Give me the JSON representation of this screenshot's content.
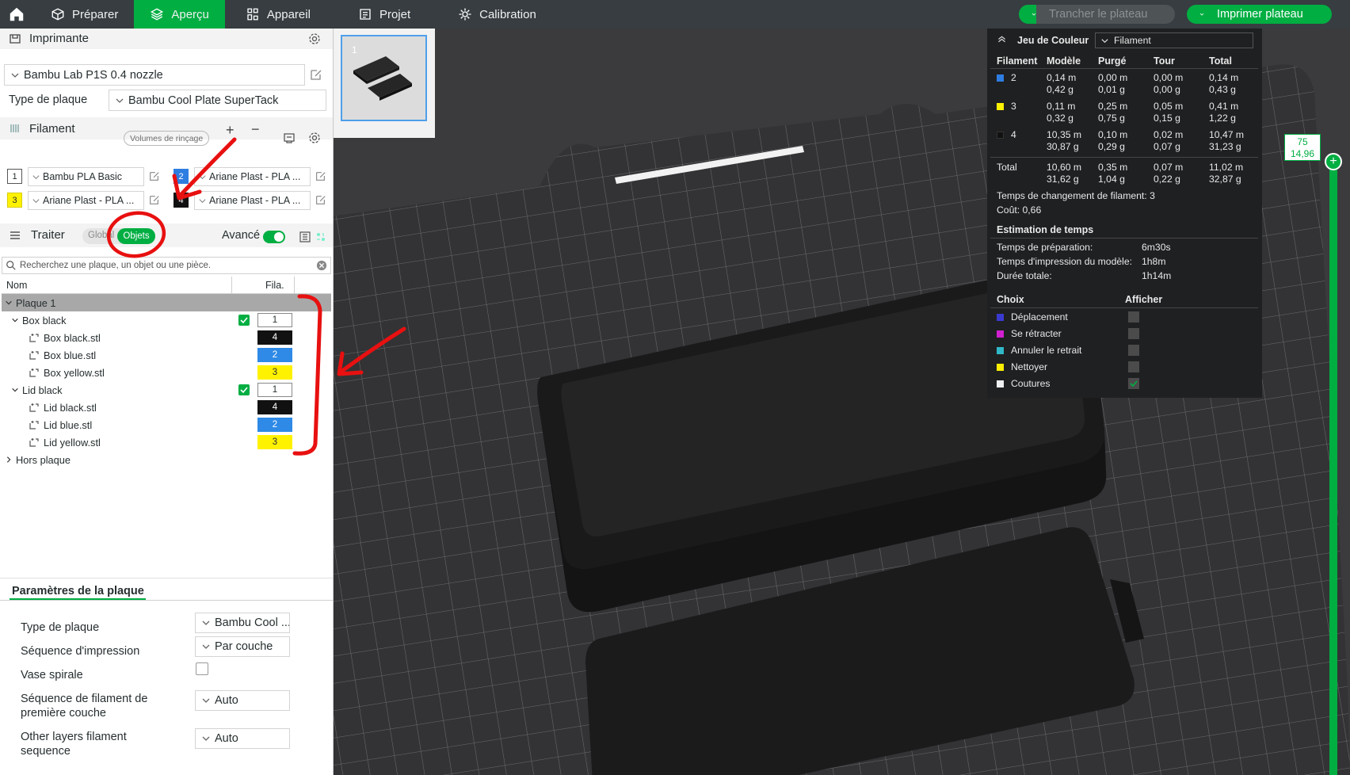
{
  "topbar": {
    "tabs": [
      {
        "label": "Préparer",
        "icon": "cube-icon"
      },
      {
        "label": "Aperçu",
        "icon": "layers-icon",
        "active": true
      },
      {
        "label": "Appareil",
        "icon": "device-icon"
      },
      {
        "label": "Projet",
        "icon": "project-icon"
      },
      {
        "label": "Calibration",
        "icon": "calibration-icon"
      }
    ],
    "slice_button": "Trancher le plateau",
    "print_button": "Imprimer plateau"
  },
  "printer": {
    "title": "Imprimante",
    "selected": "Bambu Lab P1S 0.4 nozzle",
    "plate_type_label": "Type de plaque",
    "plate_type_value": "Bambu Cool Plate SuperTack"
  },
  "filament": {
    "title": "Filament",
    "flush_button": "Volumes de rinçage",
    "slots": [
      {
        "num": "1",
        "name": "Bambu PLA Basic",
        "color": "#ffffff"
      },
      {
        "num": "2",
        "name": "Ariane Plast - PLA ...",
        "color": "#2e7de1"
      },
      {
        "num": "3",
        "name": "Ariane Plast - PLA ...",
        "color": "#fff200"
      },
      {
        "num": "4",
        "name": "Ariane Plast - PLA ...",
        "color": "#111111"
      }
    ]
  },
  "process": {
    "title": "Traiter",
    "global_tab": "Global",
    "objects_tab": "Objets",
    "advanced_label": "Avancé",
    "search_placeholder": "Recherchez une plaque, un objet ou une pièce.",
    "col_name": "Nom",
    "col_fila": "Fila."
  },
  "tree": {
    "plate": "Plaque 1",
    "objects": [
      {
        "name": "Box black",
        "fila": "1",
        "parts": [
          {
            "name": "Box black.stl",
            "fila": "4",
            "color": "#111111",
            "text": "#ffffff"
          },
          {
            "name": "Box blue.stl",
            "fila": "2",
            "color": "#2e8ae6",
            "text": "#ffffff"
          },
          {
            "name": "Box yellow.stl",
            "fila": "3",
            "color": "#fff200",
            "text": "#262e30"
          }
        ]
      },
      {
        "name": "Lid black",
        "fila": "1",
        "parts": [
          {
            "name": "Lid black.stl",
            "fila": "4",
            "color": "#111111",
            "text": "#ffffff"
          },
          {
            "name": "Lid blue.stl",
            "fila": "2",
            "color": "#2e8ae6",
            "text": "#ffffff"
          },
          {
            "name": "Lid yellow.stl",
            "fila": "3",
            "color": "#fff200",
            "text": "#262e30"
          }
        ]
      }
    ],
    "off_plate": "Hors plaque"
  },
  "plate_params": {
    "title": "Paramètres de la plaque",
    "plate_type_label": "Type de plaque",
    "plate_type_value": "Bambu Cool ...",
    "print_seq_label": "Séquence d'impression",
    "print_seq_value": "Par couche",
    "vase_label": "Vase spirale",
    "first_layer_label_1": "Séquence de filament de",
    "first_layer_label_2": "première couche",
    "first_layer_value": "Auto",
    "other_layers_label_1": "Other layers filament",
    "other_layers_label_2": "sequence",
    "other_layers_value": "Auto"
  },
  "thumbnail": {
    "number": "1"
  },
  "legend": {
    "title": "Jeu de Couleur",
    "mode": "Filament",
    "headers": [
      "Filament",
      "Modèle",
      "Purgé",
      "Tour",
      "Total"
    ],
    "rows": [
      {
        "id": "2",
        "color": "#2e7de1",
        "model": [
          "0,14 m",
          "0,42 g"
        ],
        "purged": [
          "0,00 m",
          "0,01 g"
        ],
        "tower": [
          "0,00 m",
          "0,00 g"
        ],
        "total": [
          "0,14 m",
          "0,43 g"
        ]
      },
      {
        "id": "3",
        "color": "#fff200",
        "model": [
          "0,11 m",
          "0,32 g"
        ],
        "purged": [
          "0,25 m",
          "0,75 g"
        ],
        "tower": [
          "0,05 m",
          "0,15 g"
        ],
        "total": [
          "0,41 m",
          "1,22 g"
        ]
      },
      {
        "id": "4",
        "color": "#111111",
        "model": [
          "10,35 m",
          "30,87 g"
        ],
        "purged": [
          "0,10 m",
          "0,29 g"
        ],
        "tower": [
          "0,02 m",
          "0,07 g"
        ],
        "total": [
          "10,47 m",
          "31,23 g"
        ]
      }
    ],
    "total_row": {
      "label": "Total",
      "model": [
        "10,60 m",
        "31,62 g"
      ],
      "purged": [
        "0,35 m",
        "1,04 g"
      ],
      "tower": [
        "0,07 m",
        "0,22 g"
      ],
      "total": [
        "11,02 m",
        "32,87 g"
      ]
    },
    "changes": "Temps de changement de filament:  3",
    "cost": "Coût:  0,66",
    "time_title": "Estimation de temps",
    "prep_label": "Temps de préparation:",
    "prep_value": "6m30s",
    "model_time_label": "Temps d'impression du modèle:",
    "model_time_value": "1h8m",
    "total_time_label": "Durée totale:",
    "total_time_value": "1h14m",
    "choice_header": "Choix",
    "show_header": "Afficher",
    "choices": [
      {
        "label": "Déplacement",
        "color": "#3a3ad0",
        "checked": false
      },
      {
        "label": "Se rétracter",
        "color": "#d020d0",
        "checked": false
      },
      {
        "label": "Annuler le retrait",
        "color": "#30b8c8",
        "checked": false
      },
      {
        "label": "Nettoyer",
        "color": "#ffee00",
        "checked": false
      },
      {
        "label": "Coutures",
        "color": "#f0f0f0",
        "checked": true
      }
    ]
  },
  "layer_slider": {
    "layer": "75",
    "height": "14,96"
  }
}
